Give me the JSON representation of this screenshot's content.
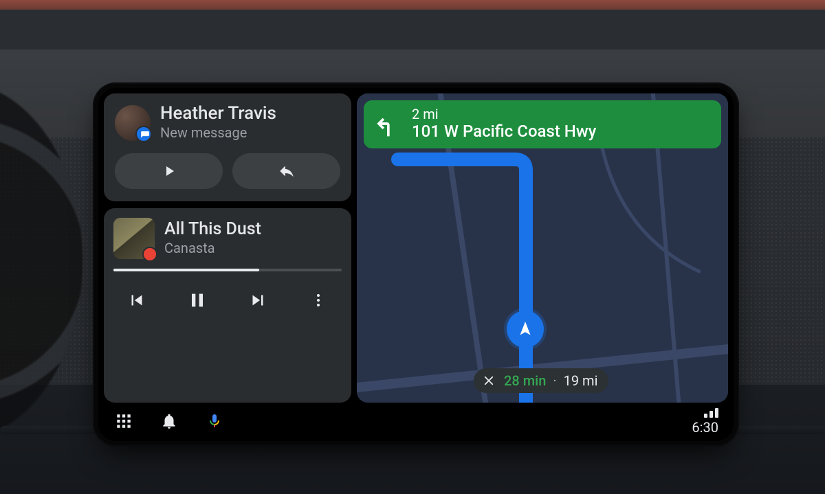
{
  "notification": {
    "sender": "Heather Travis",
    "subtitle": "New message",
    "badge_app": "messages"
  },
  "media": {
    "track": "All This Dust",
    "artist": "Canasta",
    "source_badge": "youtube-music",
    "progress_percent": 64
  },
  "navigation": {
    "banner": {
      "distance": "2 mi",
      "road": "101 W Pacific Coast Hwy",
      "maneuver": "turn-left"
    },
    "eta": {
      "time": "28 min",
      "distance": "19 mi"
    },
    "banner_color": "#1e8e3e",
    "route_color": "#1a73e8"
  },
  "systembar": {
    "clock": "6:30"
  }
}
